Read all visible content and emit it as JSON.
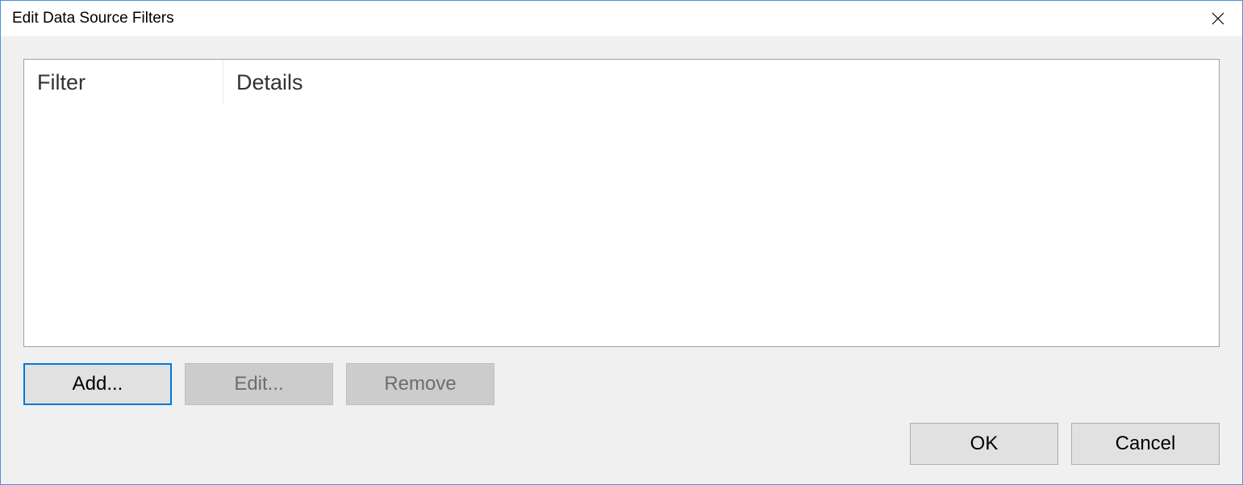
{
  "window": {
    "title": "Edit Data Source Filters"
  },
  "table": {
    "columns": {
      "filter": "Filter",
      "details": "Details"
    },
    "rows": []
  },
  "actions": {
    "add": "Add...",
    "edit": "Edit...",
    "remove": "Remove"
  },
  "footer": {
    "ok": "OK",
    "cancel": "Cancel"
  }
}
